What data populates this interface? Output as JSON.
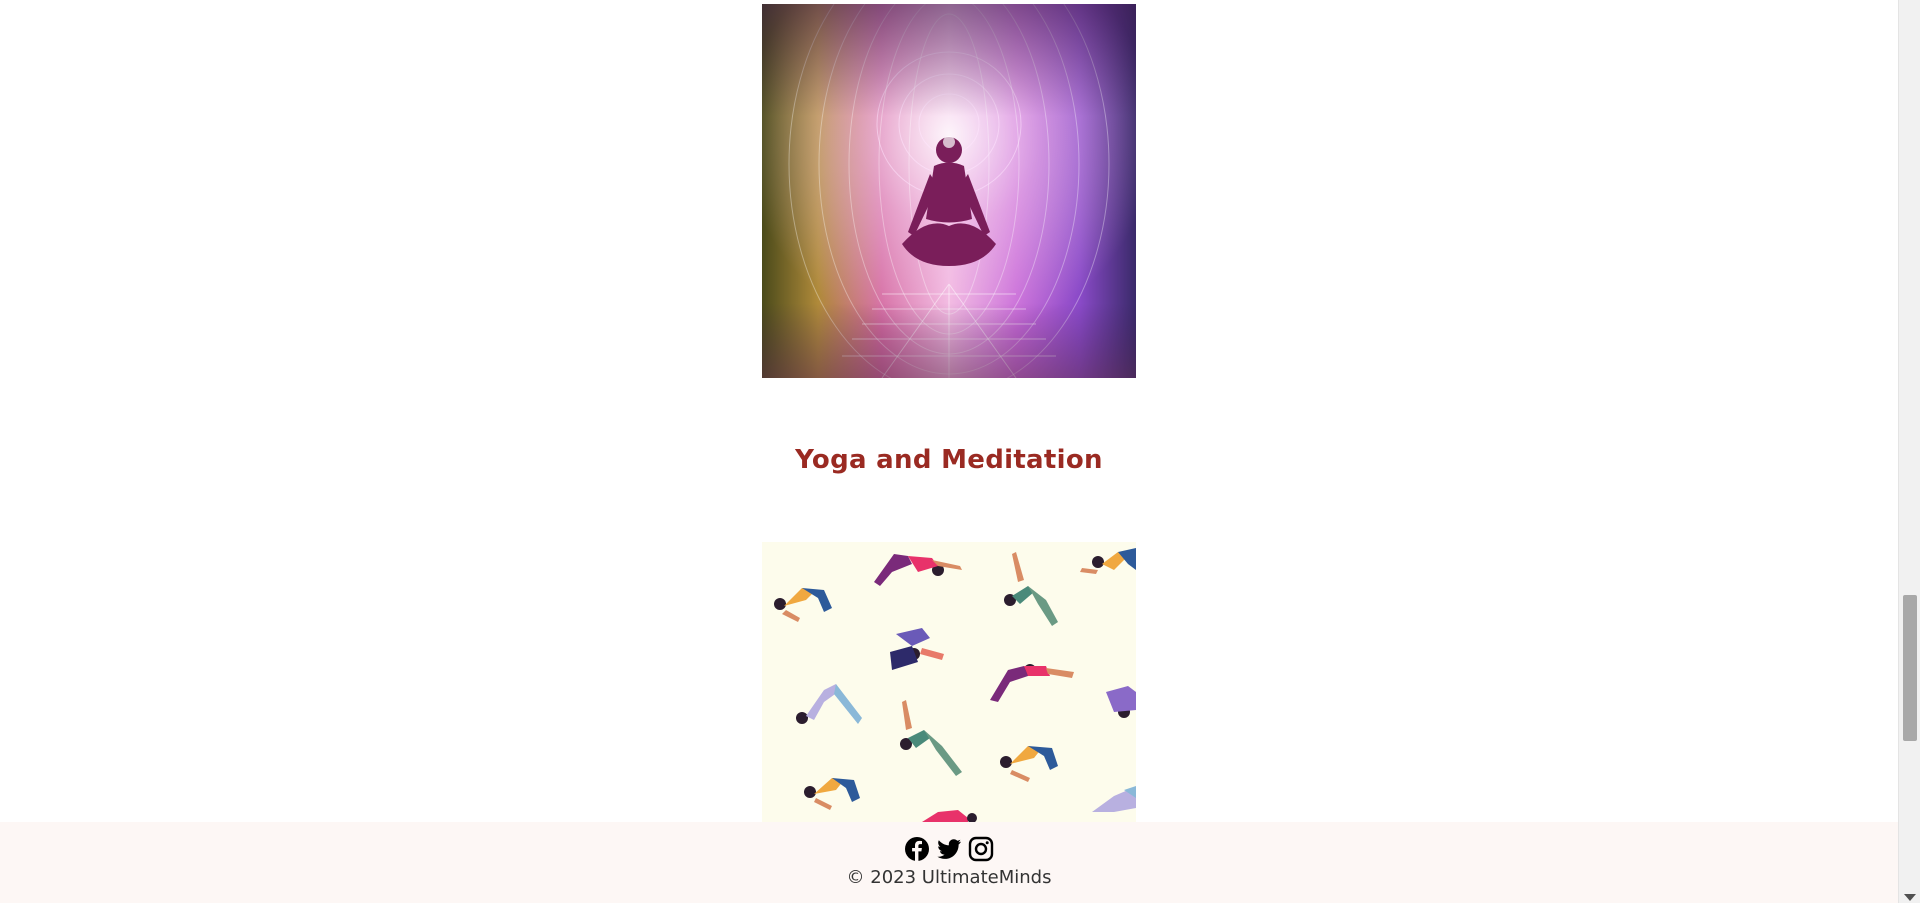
{
  "main": {
    "section_title": "Yoga and Meditation",
    "images": [
      {
        "name": "meditation-artwork",
        "alt": ""
      },
      {
        "name": "yoga-poses-illustration",
        "alt": ""
      }
    ]
  },
  "footer": {
    "social": [
      {
        "name": "facebook-icon"
      },
      {
        "name": "twitter-icon"
      },
      {
        "name": "instagram-icon"
      }
    ],
    "copyright": "© 2023 UltimateMinds"
  },
  "colors": {
    "title": "#9a2a22",
    "footer_bg": "#fdf7f5",
    "page_bg": "#ffffff"
  }
}
